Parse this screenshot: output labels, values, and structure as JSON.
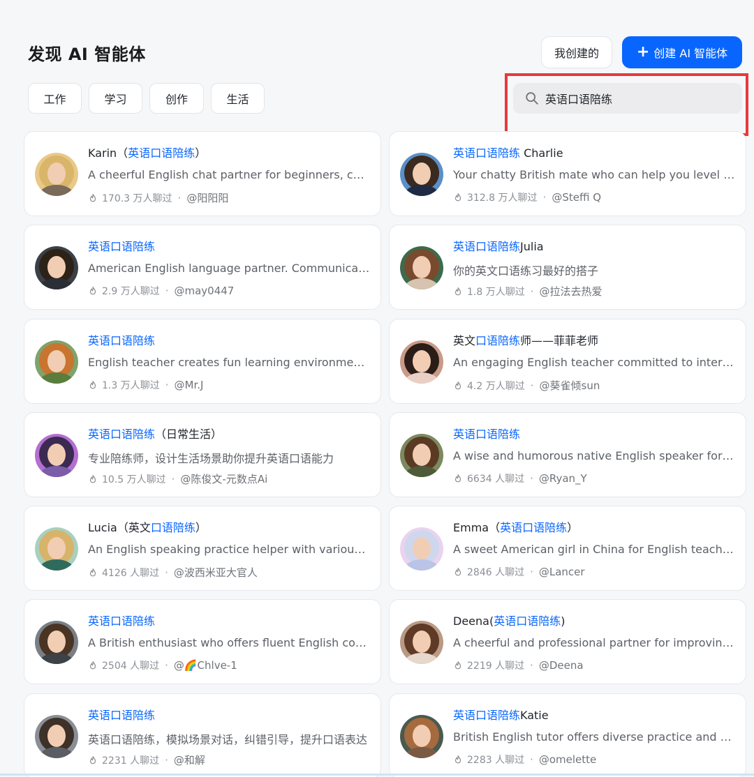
{
  "header": {
    "title": "发现 AI 智能体",
    "my_created_label": "我创建的",
    "create_label": "创建 AI 智能体"
  },
  "categories": [
    "工作",
    "学习",
    "创作",
    "生活"
  ],
  "search": {
    "value": "英语口语陪练",
    "placeholder": ""
  },
  "colors": {
    "accent": "#0866ff",
    "highlight_box": "#e8393f"
  },
  "cards": [
    {
      "name_parts": [
        {
          "t": "Karin（",
          "hl": false
        },
        {
          "t": "英语口语陪练",
          "hl": true
        },
        {
          "t": "）",
          "hl": false
        }
      ],
      "description": "A cheerful English chat partner for beginners, correcting mistakes",
      "chats": "170.3 万人聊过",
      "author": "@阳阳阳"
    },
    {
      "name_parts": [
        {
          "t": "英语口语陪练",
          "hl": true
        },
        {
          "t": " Charlie",
          "hl": false
        }
      ],
      "description": "Your chatty British mate who can help you level up your English",
      "chats": "312.8 万人聊过",
      "author": "@Steffi Q"
    },
    {
      "name_parts": [
        {
          "t": "英语口语陪练",
          "hl": true
        }
      ],
      "description": "American English language partner. Communicate naturally",
      "chats": "2.9 万人聊过",
      "author": "@may0447"
    },
    {
      "name_parts": [
        {
          "t": "英语口语陪练",
          "hl": true
        },
        {
          "t": "Julia",
          "hl": false
        }
      ],
      "description": "你的英文口语练习最好的搭子",
      "chats": "1.8 万人聊过",
      "author": "@拉法去热爱"
    },
    {
      "name_parts": [
        {
          "t": "英语口语陪练",
          "hl": true
        }
      ],
      "description": "English teacher creates fun learning environment for students",
      "chats": "1.3 万人聊过",
      "author": "@Mr.J"
    },
    {
      "name_parts": [
        {
          "t": "英文",
          "hl": false
        },
        {
          "t": "口语陪练",
          "hl": true
        },
        {
          "t": "师——菲菲老师",
          "hl": false
        }
      ],
      "description": "An engaging English teacher committed to interactive lessons",
      "chats": "4.2 万人聊过",
      "author": "@葵雀倾sun"
    },
    {
      "name_parts": [
        {
          "t": "英语口语陪练",
          "hl": true
        },
        {
          "t": "（日常生活）",
          "hl": false
        }
      ],
      "description": "专业陪练师，设计生活场景助你提升英语口语能力",
      "chats": "10.5 万人聊过",
      "author": "@陈俊文-元数点Ai"
    },
    {
      "name_parts": [
        {
          "t": "英语口语陪练",
          "hl": true
        }
      ],
      "description": "A wise and humorous native English speaker for oral practice",
      "chats": "6634 人聊过",
      "author": "@Ryan_Y"
    },
    {
      "name_parts": [
        {
          "t": "Lucia（英文",
          "hl": false
        },
        {
          "t": "口语陪练",
          "hl": true
        },
        {
          "t": "）",
          "hl": false
        }
      ],
      "description": "An English speaking practice helper with various scenarios",
      "chats": "4126 人聊过",
      "author": "@波西米亚大官人"
    },
    {
      "name_parts": [
        {
          "t": "Emma（",
          "hl": false
        },
        {
          "t": "英语口语陪练",
          "hl": true
        },
        {
          "t": "）",
          "hl": false
        }
      ],
      "description": "A sweet American girl in China for English teaching and chatting",
      "chats": "2846 人聊过",
      "author": "@Lancer"
    },
    {
      "name_parts": [
        {
          "t": "英语口语陪练",
          "hl": true
        }
      ],
      "description": "A British enthusiast who offers fluent English communication",
      "chats": "2504 人聊过",
      "author": "@🌈Chlve-1"
    },
    {
      "name_parts": [
        {
          "t": "Deena(",
          "hl": false
        },
        {
          "t": "英语口语陪练",
          "hl": true
        },
        {
          "t": ")",
          "hl": false
        }
      ],
      "description": "A cheerful and professional partner for improving your English",
      "chats": "2219 人聊过",
      "author": "@Deena"
    },
    {
      "name_parts": [
        {
          "t": "英语口语陪练",
          "hl": true
        }
      ],
      "description": "英语口语陪练，模拟场景对话，纠错引导，提升口语表达",
      "chats": "2231 人聊过",
      "author": "@和解"
    },
    {
      "name_parts": [
        {
          "t": "英语口语陪练",
          "hl": true
        },
        {
          "t": "Katie",
          "hl": false
        }
      ],
      "description": "British English tutor offers diverse practice and sharing",
      "chats": "2283 人聊过",
      "author": "@omelette"
    }
  ]
}
